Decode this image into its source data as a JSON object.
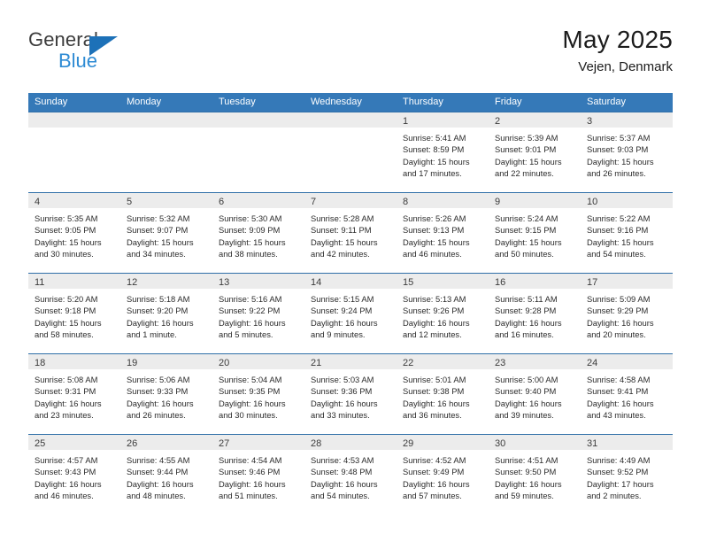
{
  "brand": {
    "line1": "General",
    "line2": "Blue",
    "accent": "#1d71b8",
    "accent_light": "#2e8bd4"
  },
  "header": {
    "title": "May 2025",
    "location": "Vejen, Denmark"
  },
  "theme": {
    "header_blue": "#3579b8",
    "row_divider": "#2f6fa8",
    "daynum_band": "#ececec",
    "text": "#2b2b2b"
  },
  "weekdays": [
    "Sunday",
    "Monday",
    "Tuesday",
    "Wednesday",
    "Thursday",
    "Friday",
    "Saturday"
  ],
  "labels": {
    "sunrise": "Sunrise:",
    "sunset": "Sunset:",
    "daylight": "Daylight:"
  },
  "weeks": [
    [
      {
        "day": "",
        "l1": "",
        "l2": "",
        "l3": "",
        "l4": ""
      },
      {
        "day": "",
        "l1": "",
        "l2": "",
        "l3": "",
        "l4": ""
      },
      {
        "day": "",
        "l1": "",
        "l2": "",
        "l3": "",
        "l4": ""
      },
      {
        "day": "",
        "l1": "",
        "l2": "",
        "l3": "",
        "l4": ""
      },
      {
        "day": "1",
        "l1": "Sunrise: 5:41 AM",
        "l2": "Sunset: 8:59 PM",
        "l3": "Daylight: 15 hours",
        "l4": "and 17 minutes."
      },
      {
        "day": "2",
        "l1": "Sunrise: 5:39 AM",
        "l2": "Sunset: 9:01 PM",
        "l3": "Daylight: 15 hours",
        "l4": "and 22 minutes."
      },
      {
        "day": "3",
        "l1": "Sunrise: 5:37 AM",
        "l2": "Sunset: 9:03 PM",
        "l3": "Daylight: 15 hours",
        "l4": "and 26 minutes."
      }
    ],
    [
      {
        "day": "4",
        "l1": "Sunrise: 5:35 AM",
        "l2": "Sunset: 9:05 PM",
        "l3": "Daylight: 15 hours",
        "l4": "and 30 minutes."
      },
      {
        "day": "5",
        "l1": "Sunrise: 5:32 AM",
        "l2": "Sunset: 9:07 PM",
        "l3": "Daylight: 15 hours",
        "l4": "and 34 minutes."
      },
      {
        "day": "6",
        "l1": "Sunrise: 5:30 AM",
        "l2": "Sunset: 9:09 PM",
        "l3": "Daylight: 15 hours",
        "l4": "and 38 minutes."
      },
      {
        "day": "7",
        "l1": "Sunrise: 5:28 AM",
        "l2": "Sunset: 9:11 PM",
        "l3": "Daylight: 15 hours",
        "l4": "and 42 minutes."
      },
      {
        "day": "8",
        "l1": "Sunrise: 5:26 AM",
        "l2": "Sunset: 9:13 PM",
        "l3": "Daylight: 15 hours",
        "l4": "and 46 minutes."
      },
      {
        "day": "9",
        "l1": "Sunrise: 5:24 AM",
        "l2": "Sunset: 9:15 PM",
        "l3": "Daylight: 15 hours",
        "l4": "and 50 minutes."
      },
      {
        "day": "10",
        "l1": "Sunrise: 5:22 AM",
        "l2": "Sunset: 9:16 PM",
        "l3": "Daylight: 15 hours",
        "l4": "and 54 minutes."
      }
    ],
    [
      {
        "day": "11",
        "l1": "Sunrise: 5:20 AM",
        "l2": "Sunset: 9:18 PM",
        "l3": "Daylight: 15 hours",
        "l4": "and 58 minutes."
      },
      {
        "day": "12",
        "l1": "Sunrise: 5:18 AM",
        "l2": "Sunset: 9:20 PM",
        "l3": "Daylight: 16 hours",
        "l4": "and 1 minute."
      },
      {
        "day": "13",
        "l1": "Sunrise: 5:16 AM",
        "l2": "Sunset: 9:22 PM",
        "l3": "Daylight: 16 hours",
        "l4": "and 5 minutes."
      },
      {
        "day": "14",
        "l1": "Sunrise: 5:15 AM",
        "l2": "Sunset: 9:24 PM",
        "l3": "Daylight: 16 hours",
        "l4": "and 9 minutes."
      },
      {
        "day": "15",
        "l1": "Sunrise: 5:13 AM",
        "l2": "Sunset: 9:26 PM",
        "l3": "Daylight: 16 hours",
        "l4": "and 12 minutes."
      },
      {
        "day": "16",
        "l1": "Sunrise: 5:11 AM",
        "l2": "Sunset: 9:28 PM",
        "l3": "Daylight: 16 hours",
        "l4": "and 16 minutes."
      },
      {
        "day": "17",
        "l1": "Sunrise: 5:09 AM",
        "l2": "Sunset: 9:29 PM",
        "l3": "Daylight: 16 hours",
        "l4": "and 20 minutes."
      }
    ],
    [
      {
        "day": "18",
        "l1": "Sunrise: 5:08 AM",
        "l2": "Sunset: 9:31 PM",
        "l3": "Daylight: 16 hours",
        "l4": "and 23 minutes."
      },
      {
        "day": "19",
        "l1": "Sunrise: 5:06 AM",
        "l2": "Sunset: 9:33 PM",
        "l3": "Daylight: 16 hours",
        "l4": "and 26 minutes."
      },
      {
        "day": "20",
        "l1": "Sunrise: 5:04 AM",
        "l2": "Sunset: 9:35 PM",
        "l3": "Daylight: 16 hours",
        "l4": "and 30 minutes."
      },
      {
        "day": "21",
        "l1": "Sunrise: 5:03 AM",
        "l2": "Sunset: 9:36 PM",
        "l3": "Daylight: 16 hours",
        "l4": "and 33 minutes."
      },
      {
        "day": "22",
        "l1": "Sunrise: 5:01 AM",
        "l2": "Sunset: 9:38 PM",
        "l3": "Daylight: 16 hours",
        "l4": "and 36 minutes."
      },
      {
        "day": "23",
        "l1": "Sunrise: 5:00 AM",
        "l2": "Sunset: 9:40 PM",
        "l3": "Daylight: 16 hours",
        "l4": "and 39 minutes."
      },
      {
        "day": "24",
        "l1": "Sunrise: 4:58 AM",
        "l2": "Sunset: 9:41 PM",
        "l3": "Daylight: 16 hours",
        "l4": "and 43 minutes."
      }
    ],
    [
      {
        "day": "25",
        "l1": "Sunrise: 4:57 AM",
        "l2": "Sunset: 9:43 PM",
        "l3": "Daylight: 16 hours",
        "l4": "and 46 minutes."
      },
      {
        "day": "26",
        "l1": "Sunrise: 4:55 AM",
        "l2": "Sunset: 9:44 PM",
        "l3": "Daylight: 16 hours",
        "l4": "and 48 minutes."
      },
      {
        "day": "27",
        "l1": "Sunrise: 4:54 AM",
        "l2": "Sunset: 9:46 PM",
        "l3": "Daylight: 16 hours",
        "l4": "and 51 minutes."
      },
      {
        "day": "28",
        "l1": "Sunrise: 4:53 AM",
        "l2": "Sunset: 9:48 PM",
        "l3": "Daylight: 16 hours",
        "l4": "and 54 minutes."
      },
      {
        "day": "29",
        "l1": "Sunrise: 4:52 AM",
        "l2": "Sunset: 9:49 PM",
        "l3": "Daylight: 16 hours",
        "l4": "and 57 minutes."
      },
      {
        "day": "30",
        "l1": "Sunrise: 4:51 AM",
        "l2": "Sunset: 9:50 PM",
        "l3": "Daylight: 16 hours",
        "l4": "and 59 minutes."
      },
      {
        "day": "31",
        "l1": "Sunrise: 4:49 AM",
        "l2": "Sunset: 9:52 PM",
        "l3": "Daylight: 17 hours",
        "l4": "and 2 minutes."
      }
    ]
  ]
}
